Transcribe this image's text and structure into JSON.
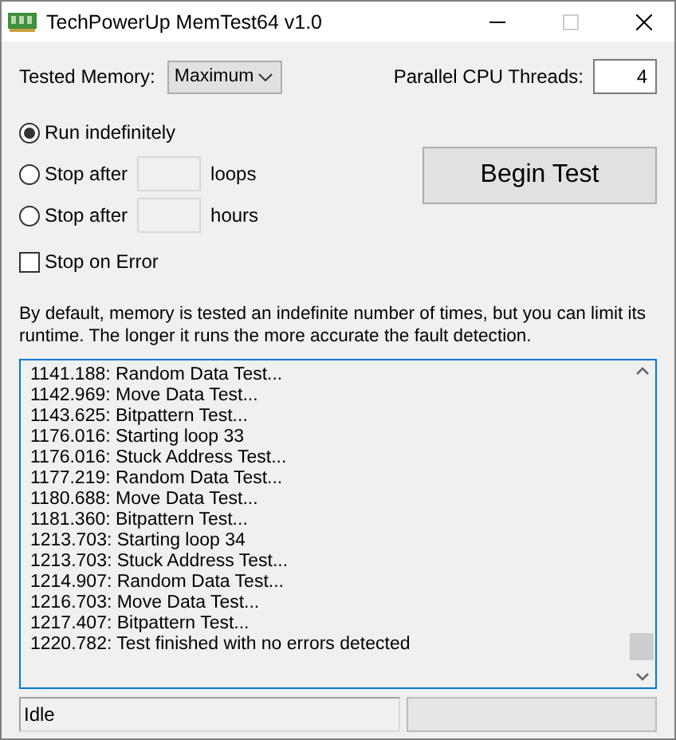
{
  "window": {
    "title": "TechPowerUp MemTest64 v1.0"
  },
  "tested_memory": {
    "label": "Tested Memory:",
    "value": "Maximum"
  },
  "threads": {
    "label": "Parallel CPU Threads:",
    "value": "4"
  },
  "run_options": [
    {
      "label": "Run indefinitely",
      "selected": true
    },
    {
      "label": "Stop after",
      "unit": "loops",
      "selected": false
    },
    {
      "label": "Stop after",
      "unit": "hours",
      "selected": false
    }
  ],
  "stop_on_error": {
    "label": "Stop on Error",
    "checked": false
  },
  "begin_button": "Begin Test",
  "description": "By default, memory is tested an indefinite number of times, but you can limit its runtime. The longer it runs the more accurate the fault detection.",
  "log": [
    "1141.188: Random Data Test...",
    "1142.969: Move Data Test...",
    "1143.625: Bitpattern Test...",
    "1176.016: Starting loop 33",
    "1176.016: Stuck Address Test...",
    "1177.219: Random Data Test...",
    "1180.688: Move Data Test...",
    "1181.360: Bitpattern Test...",
    "1213.703: Starting loop 34",
    "1213.703: Stuck Address Test...",
    "1214.907: Random Data Test...",
    "1216.703: Move Data Test...",
    "1217.407: Bitpattern Test...",
    "1220.782: Test finished with no errors detected"
  ],
  "status_bar": {
    "status": "Idle",
    "progress": {
      "level": 0
    }
  }
}
